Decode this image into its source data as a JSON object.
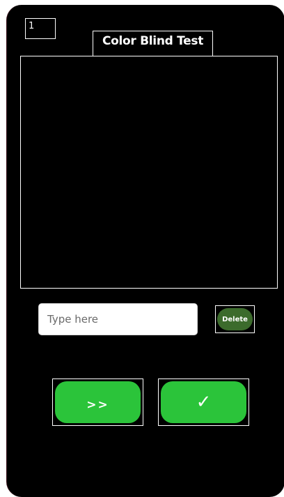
{
  "app": {
    "page_number": "1",
    "title": "Color Blind Test"
  },
  "answer": {
    "value": "",
    "placeholder": "Type here"
  },
  "buttons": {
    "delete_label": "Delete",
    "next_label": ">>",
    "submit_label": "✓"
  },
  "colors": {
    "screen_background": "#000000",
    "primary_button": "#2bc43a",
    "delete_button": "#3c6b2c",
    "outline": "#ffffff"
  },
  "icons": {
    "next": "double-chevron-right-icon",
    "submit": "checkmark-icon"
  }
}
